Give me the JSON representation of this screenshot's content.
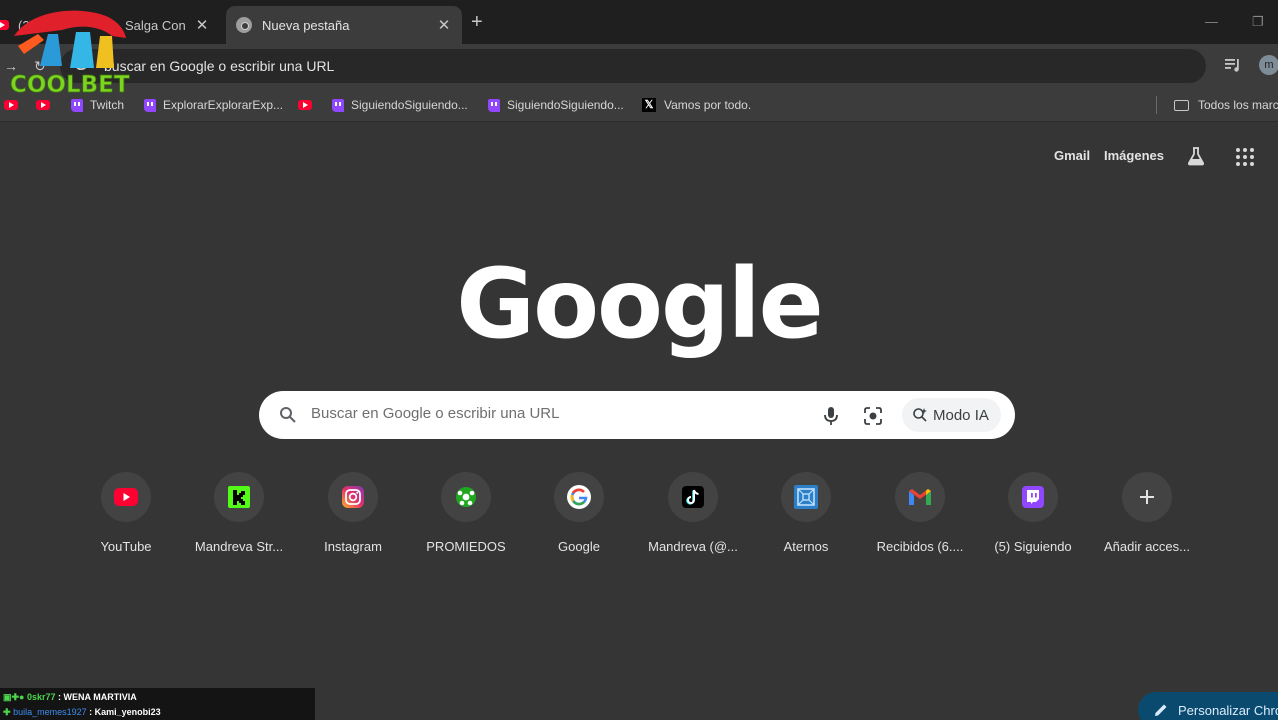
{
  "tabs": [
    {
      "title": "(2)",
      "favicon": "youtube-icon"
    },
    {
      "title": "Salga Con",
      "favicon": "none"
    },
    {
      "title": "Nueva pestaña",
      "favicon": "chrome-icon",
      "active": true
    }
  ],
  "omnibox": {
    "text": "buscar en Google o escribir una URL"
  },
  "profile": {
    "initial": "m"
  },
  "bookmarks": [
    {
      "label": "",
      "icon": "youtube-icon"
    },
    {
      "label": "",
      "icon": "youtube-icon"
    },
    {
      "label": "Twitch",
      "icon": "twitch-icon"
    },
    {
      "label": "ExplorarExplorarExp...",
      "icon": "twitch-icon"
    },
    {
      "label": "",
      "icon": "youtube-icon"
    },
    {
      "label": "SiguiendoSiguiendo...",
      "icon": "twitch-icon"
    },
    {
      "label": "SiguiendoSiguiendo...",
      "icon": "twitch-icon"
    },
    {
      "label": "Vamos por todo.",
      "icon": "x-icon"
    }
  ],
  "all_bookmarks": "Todos los marc",
  "overlay_logo": "COOLBET",
  "header": {
    "gmail": "Gmail",
    "images": "Imágenes"
  },
  "logo_text": "Google",
  "search": {
    "placeholder": "Buscar en Google o escribir una URL",
    "ai_mode": "Modo IA"
  },
  "shortcuts": [
    {
      "label": "YouTube",
      "icon": "youtube-icon"
    },
    {
      "label": "Mandreva Str...",
      "icon": "kick-icon"
    },
    {
      "label": "Instagram",
      "icon": "instagram-icon"
    },
    {
      "label": "PROMIEDOS",
      "icon": "soccer-ball-icon"
    },
    {
      "label": "Google",
      "icon": "google-icon"
    },
    {
      "label": "Mandreva (@...",
      "icon": "tiktok-icon"
    },
    {
      "label": "Aternos",
      "icon": "aternos-icon"
    },
    {
      "label": "Recibidos (6....",
      "icon": "gmail-icon"
    },
    {
      "label": "(5) Siguiendo",
      "icon": "twitch-icon"
    },
    {
      "label": "Añadir acces...",
      "icon": "plus-icon"
    }
  ],
  "chat": [
    {
      "user": "0skr77",
      "message": "WENA MARTIVIA"
    },
    {
      "user": "buila_memes1927",
      "message": "Kami_yenobi23"
    }
  ],
  "customize": "Personalizar Chro",
  "colors": {
    "background": "#353535",
    "tabstrip": "#1f1f1f",
    "toolbar": "#3c3c3c",
    "customize": "#0b4a6f"
  }
}
